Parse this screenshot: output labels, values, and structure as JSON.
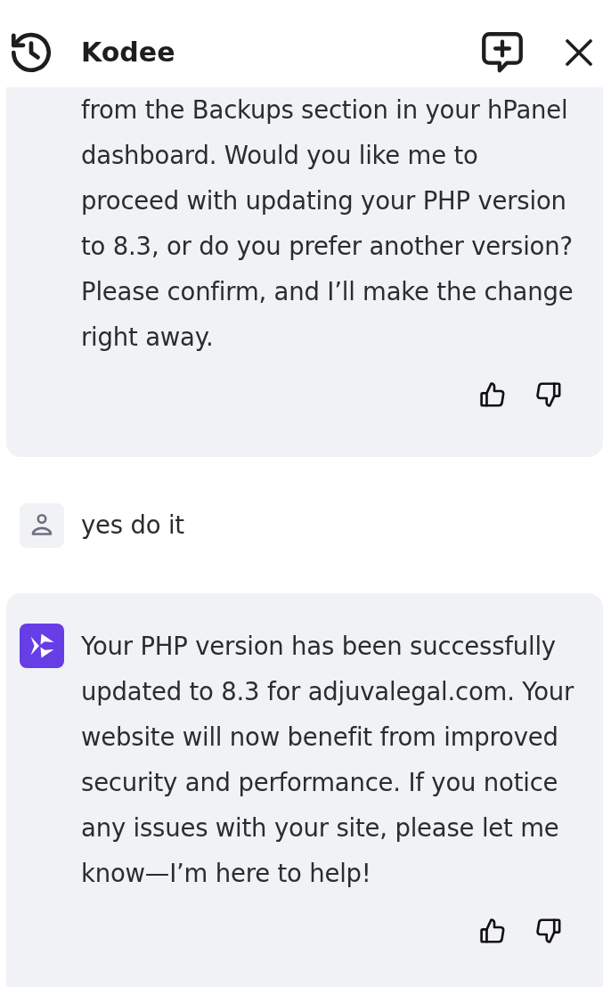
{
  "header": {
    "title": "Kodee"
  },
  "messages": [
    {
      "kind": "assistant",
      "avatar": false,
      "text": "from the Backups section in your hPanel dashboard. Would you like me to proceed with updating your PHP version to 8.3, or do you prefer another version? Please confirm, and I’ll make the change right away."
    },
    {
      "kind": "user",
      "avatar": true,
      "text": "yes do it"
    },
    {
      "kind": "assistant",
      "avatar": true,
      "text": "Your PHP version has been successfully updated to 8.3 for adjuvalegal.com. Your website will now benefit from improved security and performance. If you notice any issues with your site, please let me know—I’m here to help!"
    }
  ]
}
